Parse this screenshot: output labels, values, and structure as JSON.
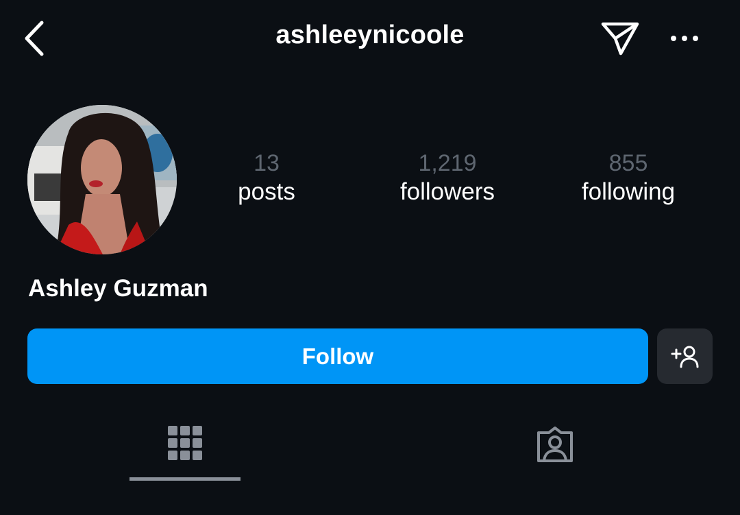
{
  "header": {
    "username": "ashleeynicoole",
    "back_icon": "chevron-left-icon",
    "send_icon": "paper-plane-icon",
    "more_icon": "ellipsis-icon"
  },
  "profile": {
    "display_name": "Ashley Guzman",
    "stats": {
      "posts": {
        "value": "13",
        "label": "posts"
      },
      "followers": {
        "value": "1,219",
        "label": "followers"
      },
      "following": {
        "value": "855",
        "label": "following"
      }
    }
  },
  "actions": {
    "follow_label": "Follow",
    "suggest_icon": "add-person-icon"
  },
  "tabs": [
    {
      "icon": "grid-icon",
      "active": true
    },
    {
      "icon": "tagged-person-icon",
      "active": false
    }
  ],
  "colors": {
    "background": "#0b0f14",
    "accent": "#0095f6",
    "muted": "#5e6670",
    "secondary_button": "#262a30"
  }
}
